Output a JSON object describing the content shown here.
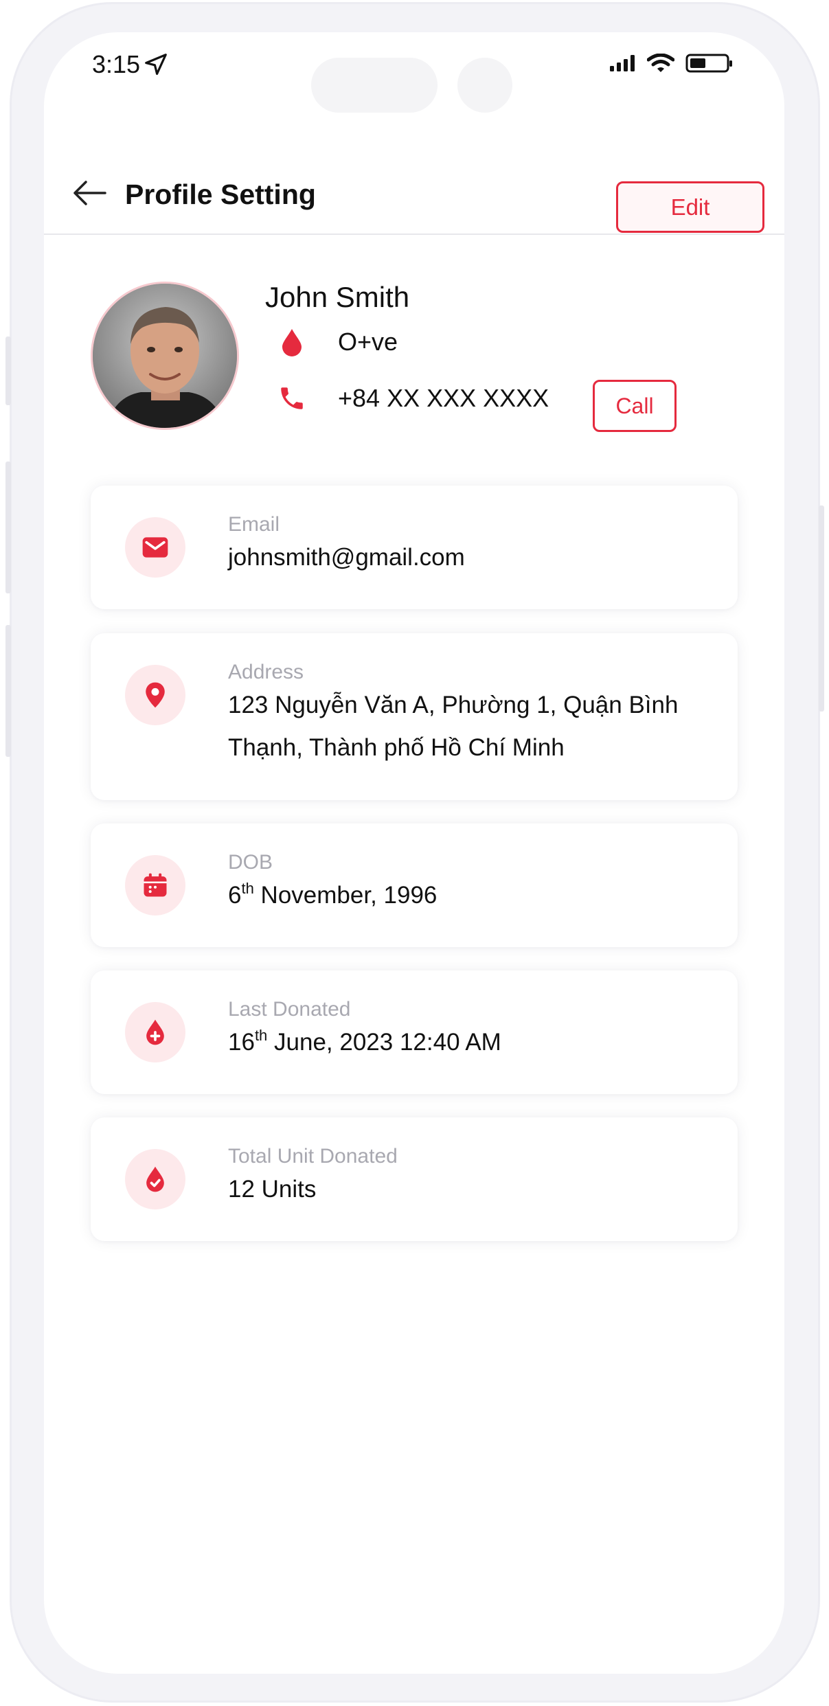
{
  "status_bar": {
    "time": "3:15"
  },
  "header": {
    "title": "Profile Setting",
    "edit_label": "Edit"
  },
  "profile": {
    "name": "John Smith",
    "blood_group": "O+ve",
    "phone": "+84 XX XXX XXXX",
    "call_label": "Call"
  },
  "cards": [
    {
      "label": "Email",
      "value": "johnsmith@gmail.com",
      "icon": "mail-icon"
    },
    {
      "label": "Address",
      "value": "123 Nguyễn Văn A, Phường 1, Quận Bình Thạnh, Thành phố Hồ Chí Minh",
      "icon": "location-pin-icon"
    },
    {
      "label": "DOB",
      "value_day": "6",
      "value_suffix": "th",
      "value_rest": " November, 1996",
      "icon": "calendar-icon"
    },
    {
      "label": "Last Donated",
      "value_day": "16",
      "value_suffix": "th",
      "value_rest": " June, 2023 12:40 AM",
      "icon": "blood-drop-plus-icon"
    },
    {
      "label": "Total Unit Donated",
      "value": "12 Units",
      "icon": "blood-drop-check-icon"
    }
  ],
  "colors": {
    "accent": "#e52a3e",
    "accent_bg": "#fde9eb",
    "label_gray": "#a8a8b0",
    "text": "#111111"
  }
}
